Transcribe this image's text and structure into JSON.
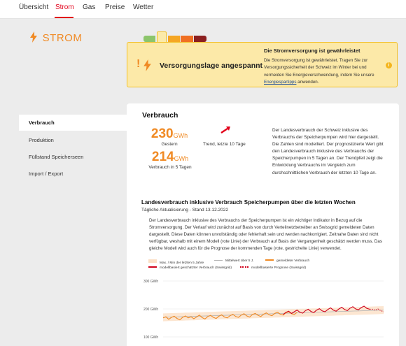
{
  "nav": {
    "tabs": [
      {
        "label": "Übersicht",
        "active": false
      },
      {
        "label": "Strom",
        "active": true
      },
      {
        "label": "Gas",
        "active": false
      },
      {
        "label": "Preise",
        "active": false
      },
      {
        "label": "Wetter",
        "active": false
      }
    ],
    "active_color": "#e2001a"
  },
  "brand": {
    "title": "STROM",
    "icon": "lightning-bolt-icon",
    "color": "#f08a24"
  },
  "status_scale": {
    "colors": [
      "#8cc56b",
      "#f5d23b",
      "#f5a623",
      "#f07022",
      "#d63b1b",
      "#7a1f1f"
    ],
    "selected_index": 1
  },
  "status": {
    "level_title": "Versorgungslage angespannt",
    "headline": "Die Stromversorgung ist gewährleistet",
    "text_before_link": "Die Stromversorgung ist gewährleistet. Tragen Sie zur Versorgungssicherheit der Schweiz im Winter bei und vermeiden Sie Energieverschwendung, indem Sie unsere",
    "link": "Energiespartipps",
    "text_after_link": "anwenden.",
    "info_icon": "info-icon"
  },
  "sidebar": {
    "items": [
      {
        "label": "Verbrauch",
        "active": true
      },
      {
        "label": "Produktion",
        "active": false
      },
      {
        "label": "Füllstand Speicherseen",
        "active": false
      },
      {
        "label": "Import / Export",
        "active": false
      }
    ]
  },
  "consumption": {
    "title": "Verbrauch",
    "yesterday": {
      "value": "230",
      "unit": "GWh",
      "label": "Gestern"
    },
    "avg5": {
      "value": "214",
      "unit": "GWh",
      "label": "Verbrauch in 5 Tagen"
    },
    "trend": {
      "label": "Trend, letzte 10 Tage",
      "direction": "up",
      "icon": "trend-arrow-icon",
      "color": "#e2001a"
    },
    "description": "Der Landesverbrauch der Schweiz inklusive des Verbrauchs der Speicherpumpen wird hier dargestellt. Die Zahlen sind modelliert. Der prognostizierte Wert gibt den Landesverbrauch inklusive des Verbrauchs der Speicherpumpen in 5 Tagen an. Der Trendpfeil zeigt die Entwicklung Verbrauchs im Vergleich zum durchschnittlichen Verbrauch der letzten 10 Tage an."
  },
  "landesverbrauch": {
    "title": "Landesverbrauch inklusive Verbrauch Speicherpumpen über die letzten Wochen",
    "meta": "Tägliche Aktualisierung - Stand 13.12.2022",
    "description": "Der Landesverbrauch inklusive des Verbrauchs der Speicherpumpen ist ein wichtiger Indikator in Bezug auf die Stromversorgung. Der Verlauf wird zunächst auf Basis von durch Verteilnetzbetreiber an Swissgrid gemeldeten Daten dargestellt. Diese Daten können unvollständig oder fehlerhaft sein und werden nachkorrigiert. Zeitnahe Daten sind nicht verfügbar, weshalb mit einem Modell (rote Linie) der Verbrauch auf Basis der Vergangenheit geschätzt werden muss. Das gleiche Modell wird auch für die Prognose der kommenden Tage (rote, gestrichelte Linie) verwendet."
  },
  "chart_data": {
    "type": "line",
    "legend": [
      {
        "label": "Max. / Min der letzten 5 Jahre",
        "color": "#fbe0c6"
      },
      {
        "label": "Mittelwert über 5 J.",
        "color": "#b5b5b5"
      },
      {
        "label": "gemeldeter Verbrauch",
        "color": "#f08a24"
      },
      {
        "label": "modellbasiert geschätzter Verbrauch (Swissgrid)",
        "color": "#d0021b"
      },
      {
        "label": "modellbasierte Prognose (Swissgrid)",
        "color": "#d0021b",
        "dashed": true
      }
    ],
    "yticks": [
      {
        "value": 300,
        "label": "300 GWh"
      },
      {
        "value": 200,
        "label": "200 GWh"
      },
      {
        "value": 100,
        "label": "100 GWh"
      }
    ],
    "ylim": [
      100,
      300
    ],
    "gemeldet": [
      168,
      172,
      163,
      170,
      174,
      166,
      161,
      170,
      175,
      168,
      172,
      165,
      171,
      178,
      169,
      164,
      173,
      177,
      170,
      166,
      174,
      179,
      171,
      168,
      176,
      181,
      173,
      170,
      178,
      183,
      175,
      171,
      180,
      184,
      177,
      173,
      181,
      186,
      179,
      176,
      184,
      188,
      181,
      178,
      186,
      190,
      183,
      180,
      188
    ],
    "modell": [
      180,
      188,
      192,
      184,
      190,
      196,
      188,
      185,
      194,
      199,
      191,
      187,
      196,
      201,
      193,
      190,
      198,
      204,
      196,
      192,
      200,
      206,
      198,
      194,
      203,
      208,
      200,
      197,
      205,
      210,
      202,
      199
    ],
    "prognose": [
      199,
      196,
      200,
      194,
      190
    ],
    "mittelwert_start": 170,
    "mittelwert_end": 196
  }
}
